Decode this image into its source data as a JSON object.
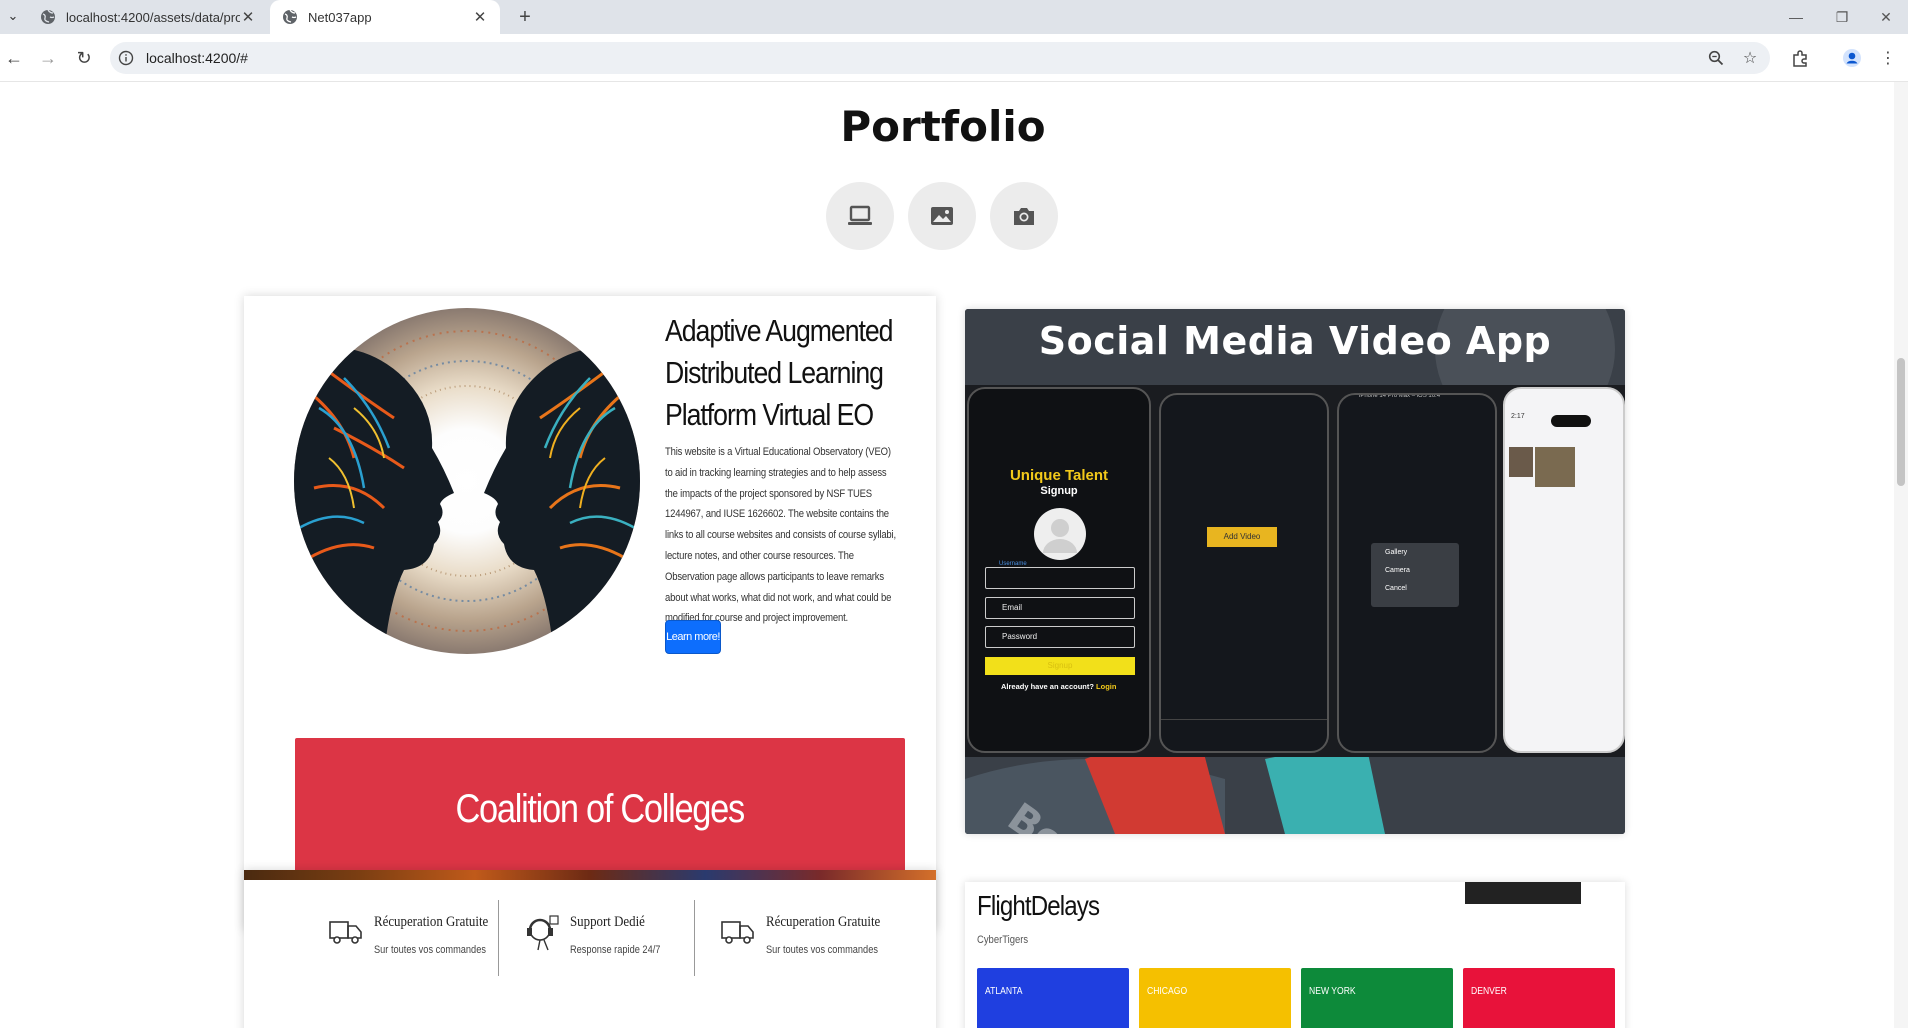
{
  "browser": {
    "tabs": [
      {
        "title": "localhost:4200/assets/data/proj",
        "active": false
      },
      {
        "title": "Net037app",
        "active": true
      }
    ],
    "url": "localhost:4200/#"
  },
  "page": {
    "title": "Portfolio",
    "filters": [
      "laptop-icon",
      "image-icon",
      "camera-icon"
    ]
  },
  "card_project": {
    "title": "Adaptive Augmented Distributed Learning Platform Virtual EO",
    "description": "This website is a Virtual Educational Observatory (VEO) to aid in tracking learning strategies and to help assess the impacts of the project sponsored by NSF TUES 1244967, and IUSE 1626602. The website contains the links to all course websites and consists of course syllabi, lecture notes, and other course resources. The Observation page allows participants to leave remarks about what works, what did not work, and what could be modified for course and project improvement.",
    "button_label": "Learn more!",
    "banner_label": "Coalition of Colleges"
  },
  "card_video": {
    "title": "Social Media Video App",
    "screen": {
      "app_name": "Unique Talent",
      "signup_heading": "Signup",
      "username_label": "Username",
      "email_placeholder": "Email",
      "password_placeholder": "Password",
      "signup_button": "Signup",
      "login_prompt": "Already have an account?",
      "login_link": "Login",
      "add_video": "Add Video",
      "menu_items": [
        "Gallery",
        "Camera",
        "Cancel"
      ],
      "simulator_title": "iPhone 14 Pro Max – iOS 16.4",
      "clock": "2:17"
    }
  },
  "card_services": {
    "features": [
      {
        "title": "Récuperation Gratuite",
        "subtitle": "Sur toutes vos commandes",
        "icon": "truck-icon"
      },
      {
        "title": "Support Dedié",
        "subtitle": "Response rapide 24/7",
        "icon": "support-icon"
      },
      {
        "title": "Récuperation Gratuite",
        "subtitle": "Sur toutes vos commandes",
        "icon": "truck-icon"
      }
    ]
  },
  "card_flights": {
    "title": "FlightDelays",
    "subtitle": "CyberTigers",
    "cities": [
      {
        "name": "ATLANTA",
        "color": "#1f3fe0"
      },
      {
        "name": "CHICAGO",
        "color": "#f5c000"
      },
      {
        "name": "NEW YORK",
        "color": "#0d8a3a"
      },
      {
        "name": "DENVER",
        "color": "#e8123a"
      }
    ]
  }
}
